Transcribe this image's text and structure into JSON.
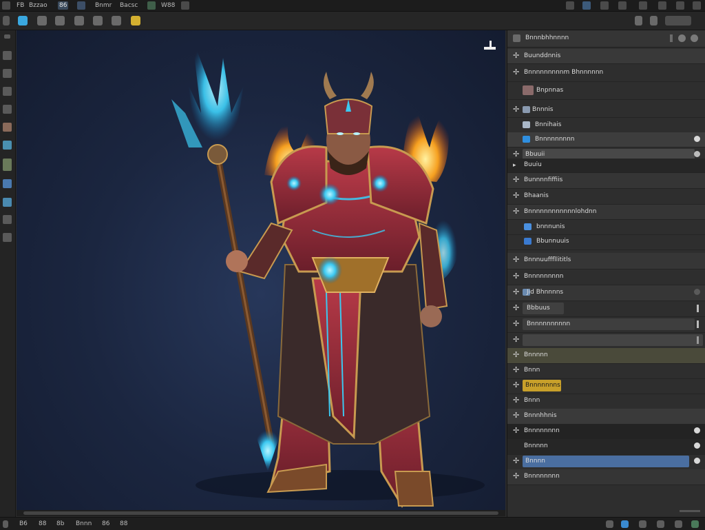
{
  "menubar": {
    "items": [
      "FB",
      "Bzzao",
      "86",
      "Bnmr",
      "Bacsc",
      "W88"
    ]
  },
  "right_panel": {
    "title": "Bnnnbhhnnnn",
    "rows": [
      {
        "label": "Buunddnnis"
      },
      {
        "label": "Bnnnnnnnnnm Bhnnnnnn"
      },
      {
        "label": "Bnpnnas"
      },
      {
        "label": "Bnnnis"
      },
      {
        "label": "Bnnihais"
      },
      {
        "label": "Bnnnnnnnnn"
      },
      {
        "label": "Bbuuii"
      },
      {
        "label": "Buuiu"
      },
      {
        "label": "Bunnnnfiffiis"
      },
      {
        "label": "Bhaanis"
      },
      {
        "label": "Bnnnnnnnnnnnnlohdnn"
      },
      {
        "label": "bnnnunis"
      },
      {
        "label": "Bbunnuuis"
      },
      {
        "label": "Bnnnuufffllititls"
      },
      {
        "label": "Bnnnnnnnnn"
      },
      {
        "label": "Jid Bhnnnns"
      },
      {
        "label": "Bbbuus"
      },
      {
        "label": "Bnnnnnnnnnn"
      },
      {
        "label": ""
      },
      {
        "label": "Bnnnnn"
      },
      {
        "label": "Bnnn"
      },
      {
        "label": "Bnnnnnnns"
      },
      {
        "label": "Bnnn"
      },
      {
        "label": "Bnnnhhnis"
      },
      {
        "label": "Bnnnnnnnn"
      },
      {
        "label": "Bnnnnn"
      },
      {
        "label": "Bnnnn"
      },
      {
        "label": "Bnnnnnnnn"
      }
    ]
  },
  "statusbar": {
    "items": [
      "B6",
      "88",
      "8b",
      "Bnnn",
      "86",
      "88"
    ],
    "right_icons": [
      "blue-icon",
      "globe-icon"
    ]
  },
  "colors": {
    "selection": "#4a6ea0",
    "accent_blue": "#2f8fe0",
    "accent_yellow": "#c8a02a",
    "accent_olive": "#4a4a3a"
  }
}
